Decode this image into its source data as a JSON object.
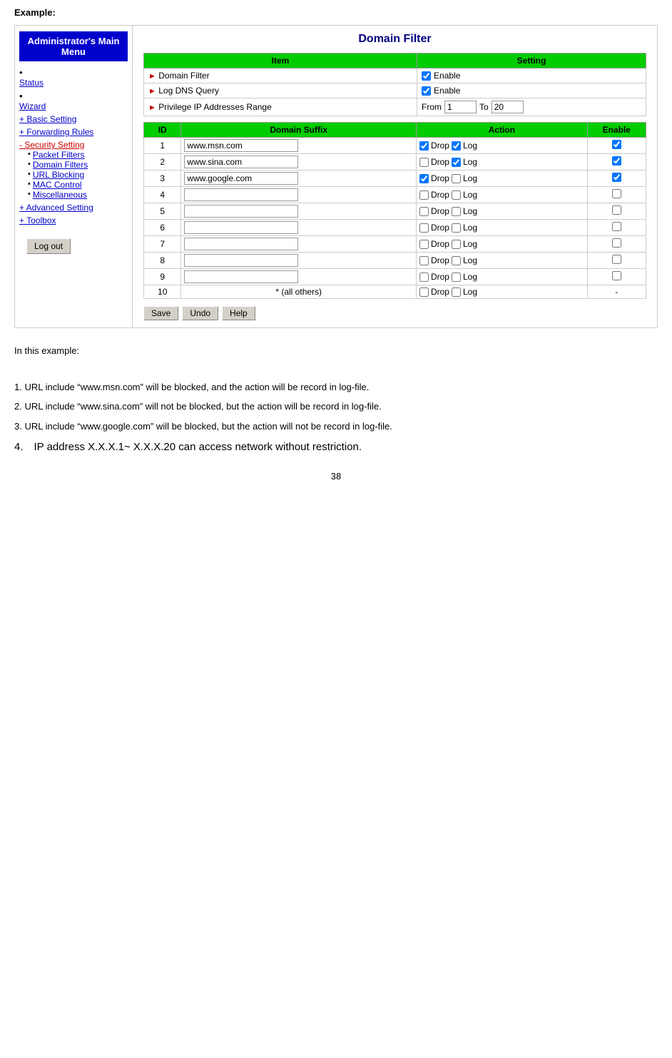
{
  "page": {
    "example_heading": "Example:",
    "page_number": "38"
  },
  "sidebar": {
    "title_line1": "Administrator's Main",
    "title_line2": "Menu",
    "status_label": "Status",
    "wizard_label": "Wizard",
    "basic_setting_label": "+ Basic Setting",
    "forwarding_rules_label": "+ Forwarding Rules",
    "security_setting_label": "- Security Setting",
    "sub_items": [
      {
        "label": "Packet Filters"
      },
      {
        "label": "Domain Filters"
      },
      {
        "label": "URL Blocking"
      },
      {
        "label": "MAC Control"
      },
      {
        "label": "Miscellaneous"
      }
    ],
    "advanced_setting_label": "+ Advanced Setting",
    "toolbox_label": "+ Toolbox",
    "logout_label": "Log out"
  },
  "main": {
    "title": "Domain Filter",
    "table_headers": [
      "Item",
      "Setting"
    ],
    "rows": [
      {
        "item": "Domain Filter",
        "setting_type": "checkbox_enable",
        "checked": true
      },
      {
        "item": "Log DNS Query",
        "setting_type": "checkbox_enable",
        "checked": true
      },
      {
        "item": "Privilege IP Addresses Range",
        "setting_type": "from_to",
        "from": "1",
        "to": "20"
      }
    ],
    "domain_table": {
      "headers": [
        "ID",
        "Domain Suffix",
        "Action",
        "Enable"
      ],
      "rows": [
        {
          "id": 1,
          "suffix": "www.msn.com",
          "drop": true,
          "log": true,
          "enable": true
        },
        {
          "id": 2,
          "suffix": "www.sina.com",
          "drop": false,
          "log": true,
          "enable": true
        },
        {
          "id": 3,
          "suffix": "www.google.com",
          "drop": true,
          "log": false,
          "enable": true
        },
        {
          "id": 4,
          "suffix": "",
          "drop": false,
          "log": false,
          "enable": false
        },
        {
          "id": 5,
          "suffix": "",
          "drop": false,
          "log": false,
          "enable": false
        },
        {
          "id": 6,
          "suffix": "",
          "drop": false,
          "log": false,
          "enable": false
        },
        {
          "id": 7,
          "suffix": "",
          "drop": false,
          "log": false,
          "enable": false
        },
        {
          "id": 8,
          "suffix": "",
          "drop": false,
          "log": false,
          "enable": false
        },
        {
          "id": 9,
          "suffix": "",
          "drop": false,
          "log": false,
          "enable": false
        },
        {
          "id": 10,
          "suffix": "* (all others)",
          "drop": false,
          "log": false,
          "enable": null
        }
      ]
    },
    "buttons": [
      "Save",
      "Undo",
      "Help"
    ]
  },
  "text_content": {
    "intro": "In this example:",
    "items": [
      "1. URL include “www.msn.com” will be blocked, and the action will be record in log-file.",
      "2. URL include “www.sina.com” will not be blocked, but the action will be record in log-file.",
      "3. URL include “www.google.com” will be blocked, but the action will not be record in log-file.",
      "4. IP address X.X.X.1~ X.X.X.20 can access network without restriction."
    ]
  }
}
